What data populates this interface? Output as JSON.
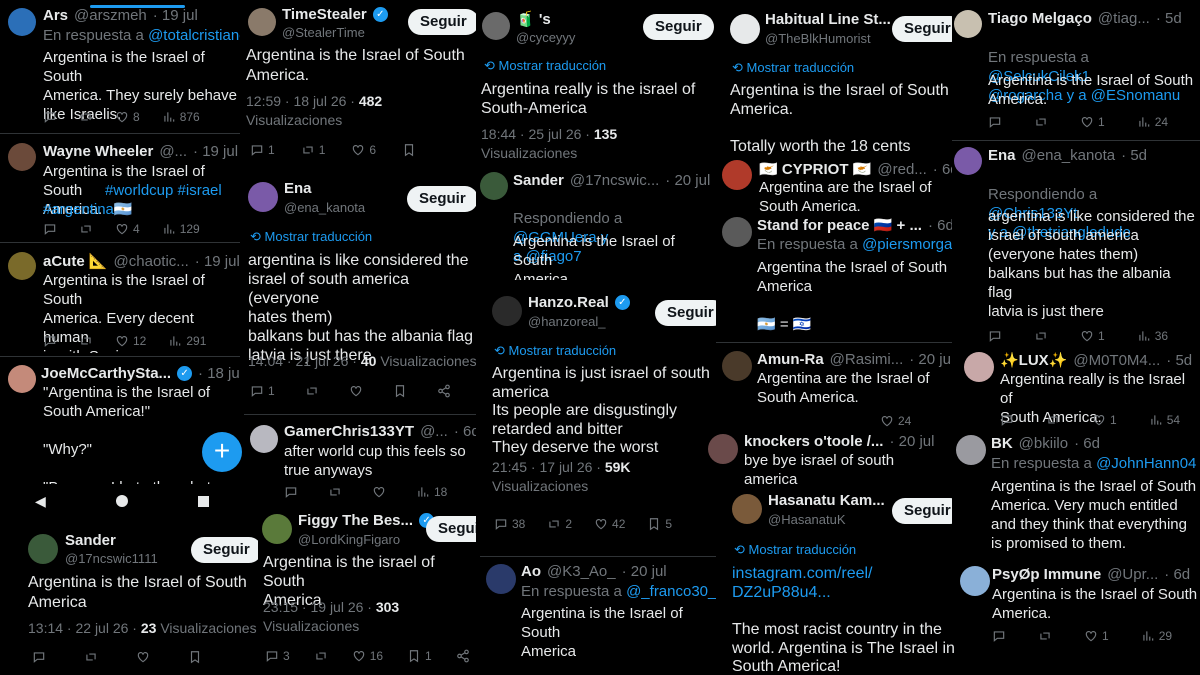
{
  "common": {
    "follow": "Seguir",
    "translate": "Mostrar traducción",
    "views_word": "Visualizaciones"
  },
  "colors": {
    "accent": "#1d9bf0",
    "bg": "#000000",
    "text": "#e7e9ea",
    "muted": "#71767b"
  },
  "c1": [
    {
      "name": "Ars",
      "handle": "@arszmeh",
      "date": "· 19 jul",
      "reply_prefix": "En respuesta a",
      "reply_to": "@totalcristiano",
      "text": "Argentina is the Israel of South\nAmerica. They surely behave\nlike Israelis.",
      "likes": "8",
      "views": "876"
    },
    {
      "name": "Wayne Wheeler",
      "handle": "@...",
      "date": "· 19 jul",
      "text": "Argentina is the Israel of South\nAmerica.",
      "tags": "#worldcup #israel\n#argentina",
      "flag": "🇦🇷",
      "likes": "4",
      "views": "129"
    },
    {
      "name": "aCute 📐",
      "handle": "@chaotic...",
      "date": "· 19 jul",
      "text": "Argentina is the Israel of South\nAmerica. Every decent human\nis with Spain.",
      "likes": "12",
      "views": "291"
    },
    {
      "name": "JoeMcCarthySta...",
      "date": "· 18 jul",
      "text": "\"Argentina is the Israel of\nSouth America!\"\n\n\"Why?\"\n\n\"Because I hate them but they\nalways win\""
    },
    {
      "name": "Sander",
      "handle": "@17ncswic1111",
      "text": "Argentina is the Israel of South\nAmerica",
      "time": "13:14 · 22 jul 26 ·",
      "views": "23"
    }
  ],
  "c2": [
    {
      "name": "TimeStealer",
      "handle": "@StealerTime",
      "text": "Argentina is the Israel of South\nAmerica.",
      "time": "12:59 · 18 jul 26 ·",
      "views": "482",
      "replies": "1",
      "retweets": "1",
      "likes": "6"
    },
    {
      "name": "Ena",
      "handle": "@ena_kanota",
      "text": "argentina is like considered the\nisrael of south america (everyone\nhates them)\nbalkans but has the albania flag\nlatvia is just there",
      "time": "14:04 · 21 jul 26 ·",
      "views": "40",
      "replies": "1"
    },
    {
      "name": "GamerChris133YT",
      "handle": "@...",
      "date": "· 6d",
      "text": "after world cup this feels so\ntrue anyways",
      "views": "18"
    },
    {
      "name": "Figgy The Bes...",
      "handle": "@LordKingFigaro",
      "text": "Argentina is the israel of South\nAmerica",
      "time": "23:15 · 19 jul 26 ·",
      "views": "303",
      "replies": "3",
      "likes": "16",
      "bookmarks": "1"
    }
  ],
  "c3": [
    {
      "name": "🧃 's",
      "handle": "@cyceyyy",
      "text": "Argentina really is the israel of\nSouth-America",
      "time": "18:44 · 25 jul 26 ·",
      "views": "135"
    },
    {
      "name": "Sander",
      "handle": "@17ncswic...",
      "date": "· 20 jul",
      "reply_prefix": "Respondiendo a",
      "reply_to": "@GGMUera y\na @fiago7",
      "text": "Argentina is the Israel of South\nAmerica."
    },
    {
      "name": "Hanzo.Real",
      "handle": "@hanzoreal_",
      "text": "Argentina is just israel of south\namerica\nIts people are disgustingly\nretarded and bitter\nThey deserve the worst",
      "time": "21:45 · 17 jul 26 ·",
      "views": "59K",
      "replies": "38",
      "retweets": "2",
      "likes": "42",
      "bookmarks": "5"
    },
    {
      "name": "Ao",
      "handle": "@K3_Ao_",
      "date": "· 20 jul",
      "reply_prefix": "En respuesta a",
      "reply_to": "@_franco30_",
      "text": "Argentina is the Israel of South\nAmerica"
    }
  ],
  "c4": [
    {
      "name": "Habitual Line St...",
      "handle": "@TheBlkHumorist",
      "text": "Argentina is the Israel of South\nAmerica.\n\nTotally worth the 18 cents"
    },
    {
      "name": "🇨🇾 CYPRIOT 🇨🇾",
      "handle": "@red...",
      "date": "· 6d",
      "text": "Argentina are the Israel of\nSouth America."
    },
    {
      "name": "Stand for peace 🇷🇺 + ...",
      "date": "· 6d",
      "reply_prefix": "En respuesta a",
      "reply_to": "@piersmorgan",
      "text": "Argentina the Israel of South\nAmerica\n\n🇦🇷 = 🇮🇱"
    },
    {
      "name": "Amun-Ra",
      "handle": "@Rasimi...",
      "date": "· 20 jul",
      "text": "Argentina are the Israel of\nSouth America.",
      "views": "24"
    },
    {
      "name": "knockers o'toole /...",
      "date": "· 20 jul",
      "text": "bye bye israel of south america\n(argentina)"
    },
    {
      "name": "Hasanatu Kam...",
      "handle": "@HasanatuK",
      "link": "instagram.com/reel/\nDZ2uP88u4...",
      "text": "The most racist country in the\nworld.  Argentina is The Israel in\nSouth America!"
    }
  ],
  "c5": [
    {
      "name": "Tiago Melgaço",
      "handle": "@tiag...",
      "date": "· 5d",
      "reply_prefix": "En respuesta a",
      "reply_to": "@SelcukCilek1\n@rogarcha y a @ESnomanu",
      "text": "Argentina is the Israel of South\nAmerica.",
      "replies": "1",
      "views": "24"
    },
    {
      "name": "Ena",
      "handle": "@ena_kanota",
      "date": "· 5d",
      "reply_prefix": "Respondiendo a",
      "reply_to": "@Chris133Yt\ny a @thetriangledude",
      "text": "argentina is like considered the\nisrael of south america\n(everyone hates them)\nbalkans but has the albania\nflag\nlatvia is just there",
      "replies": "1",
      "views": "36"
    },
    {
      "name": "✨LUX✨",
      "handle": "@M0T0M4...",
      "date": "· 5d",
      "text": "Argentina really is the Israel of\nSouth America.",
      "replies": "1",
      "views": "54"
    },
    {
      "name": "BK",
      "handle": "@bkiilo",
      "date": "· 6d",
      "reply_prefix": "En respuesta a",
      "reply_to": "@JohnHann04",
      "text": "Argentina is the Israel of South\nAmerica. Very much entitled\nand they think that everything\nis promised to them."
    },
    {
      "name": "PsyØp Immune",
      "handle": "@Upr...",
      "date": "· 6d",
      "text": "Argentina is the Israel of South\nAmerica.",
      "replies": "1",
      "views": "29"
    }
  ]
}
